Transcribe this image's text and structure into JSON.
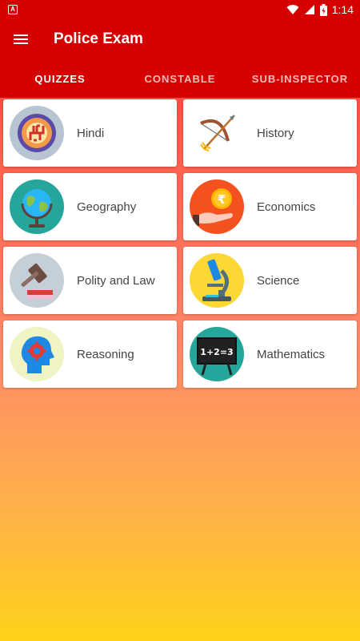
{
  "status_bar": {
    "time": "1:14",
    "notification_icon": "A"
  },
  "app_bar": {
    "title": "Police Exam"
  },
  "tabs": [
    {
      "label": "QUIZZES",
      "active": true
    },
    {
      "label": "CONSTABLE",
      "active": false
    },
    {
      "label": "SUB-INSPECTOR",
      "active": false
    }
  ],
  "categories": [
    {
      "label": "Hindi",
      "icon": "swastika-icon",
      "icon_bg": "#b7c4d1"
    },
    {
      "label": "History",
      "icon": "bow-arrow-icon",
      "icon_bg": "#ffffff"
    },
    {
      "label": "Geography",
      "icon": "globe-icon",
      "icon_bg": "#26a69a"
    },
    {
      "label": "Economics",
      "icon": "rupee-coin-hand-icon",
      "icon_bg": "#f4511e"
    },
    {
      "label": "Polity and Law",
      "icon": "gavel-icon",
      "icon_bg": "#c5cfd8"
    },
    {
      "label": "Science",
      "icon": "microscope-icon",
      "icon_bg": "#fdd835"
    },
    {
      "label": "Reasoning",
      "icon": "brain-head-icon",
      "icon_bg": "#f0f4c3"
    },
    {
      "label": "Mathematics",
      "icon": "blackboard-icon",
      "icon_bg": "#26a69a",
      "board_text": "1+2=3"
    }
  ],
  "colors": {
    "primary": "#d50000",
    "gradient_bottom": "#ffd21a"
  }
}
